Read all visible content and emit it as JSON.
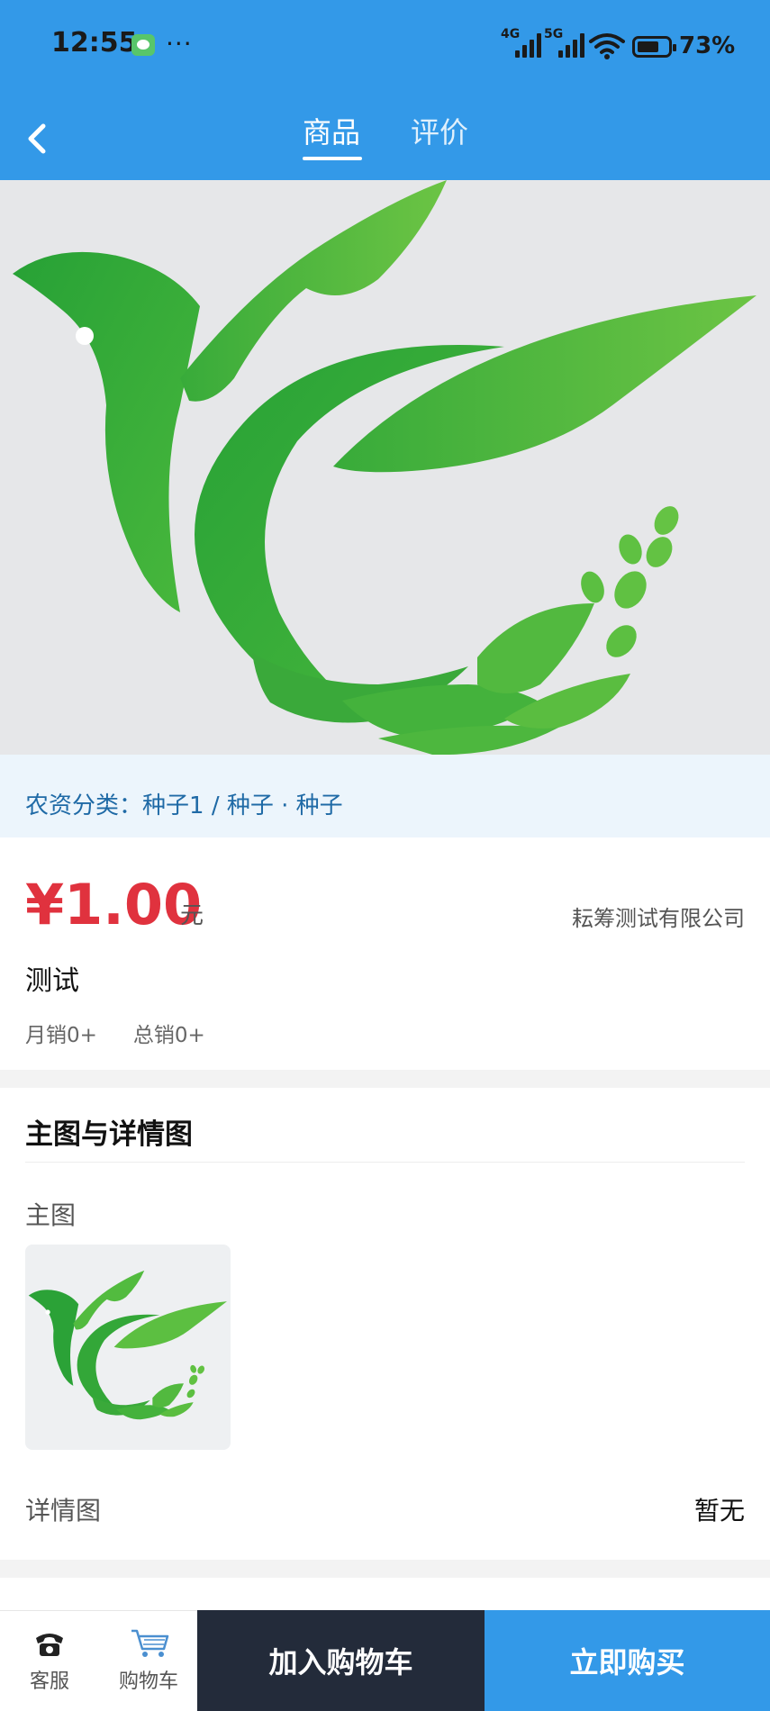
{
  "status_bar": {
    "time": "12:55",
    "more": "···",
    "net1": "4G",
    "net2": "5G",
    "battery": "73%",
    "battery_level": 0.73
  },
  "header": {
    "tabs": [
      {
        "label": "商品",
        "active": true
      },
      {
        "label": "评价",
        "active": false
      }
    ],
    "colors": {
      "primary": "#3399e8",
      "price": "#e0323e",
      "dark": "#232b3a"
    }
  },
  "category": {
    "label": "农资分类：",
    "value": "种子1 / 种子 · 种子"
  },
  "product": {
    "price": "¥1.00",
    "unit": "元",
    "company": "耘筹测试有限公司",
    "name": "测试",
    "monthly_sales": "月销0+",
    "total_sales": "总销0+"
  },
  "images_section": {
    "title": "主图与详情图",
    "main_label": "主图",
    "detail_label": "详情图",
    "detail_value": "暂无"
  },
  "bottom_bar": {
    "service_label": "客服",
    "service_icon": "phone-icon",
    "cart_label": "购物车",
    "cart_icon": "cart-icon",
    "add_to_cart": "加入购物车",
    "buy_now": "立即购买"
  }
}
